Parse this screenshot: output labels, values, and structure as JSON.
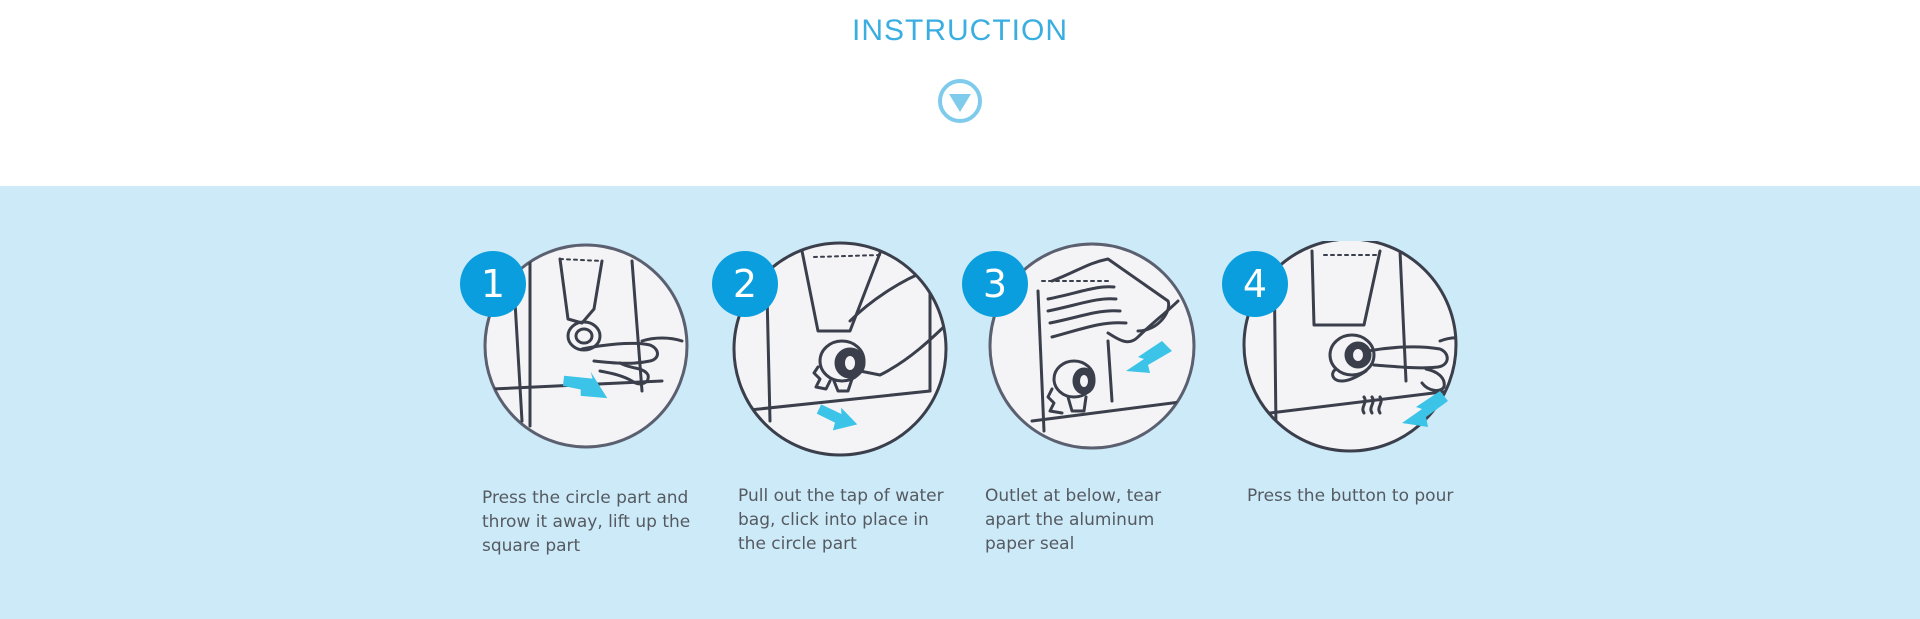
{
  "title": "INSTRUCTION",
  "colors": {
    "title": "#3aaee0",
    "band": "#cdeaf8",
    "badge": "#0a9ede",
    "arrow": "#3cc3e8",
    "line": "#3b3f4c"
  },
  "icons": {
    "scroll": "down-triangle-circle-icon"
  },
  "steps": [
    {
      "number": "1",
      "caption": "Press the circle part and throw it away, lift up the square part"
    },
    {
      "number": "2",
      "caption": "Pull out the tap of water bag, click into place in the circle part"
    },
    {
      "number": "3",
      "caption": "Outlet at below, tear apart the aluminum paper seal"
    },
    {
      "number": "4",
      "caption": "Press the button to pour"
    }
  ]
}
